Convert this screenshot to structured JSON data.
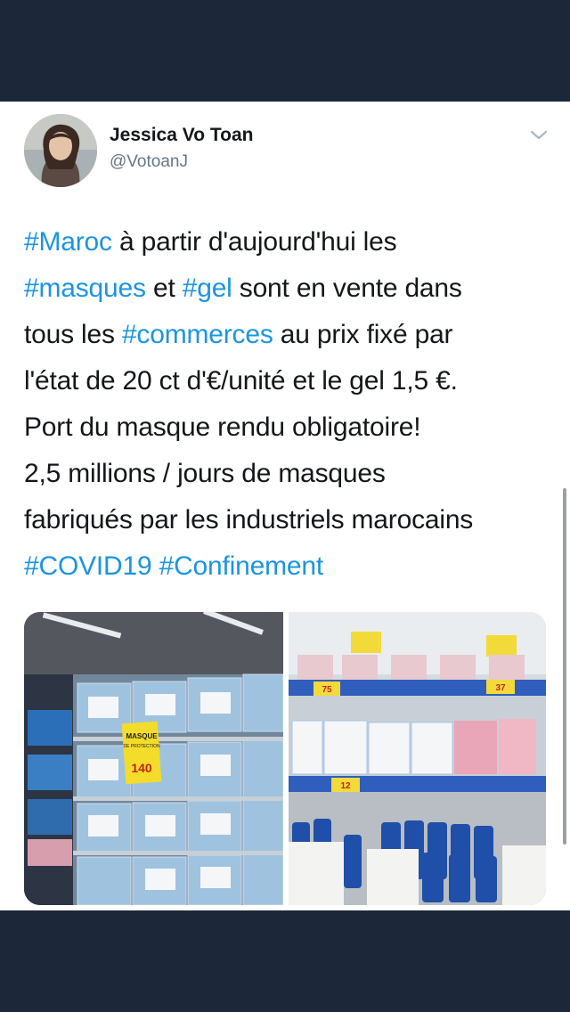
{
  "author": {
    "name": "Jessica Vo Toan",
    "handle": "@VotoanJ"
  },
  "tweet": {
    "lines": [
      [
        {
          "text": "#Maroc",
          "tag": true
        },
        {
          "text": " à partir d'aujourd'hui les",
          "tag": false
        }
      ],
      [
        {
          "text": "#masques",
          "tag": true
        },
        {
          "text": " et ",
          "tag": false
        },
        {
          "text": "#gel",
          "tag": true
        },
        {
          "text": " sont en vente dans",
          "tag": false
        }
      ],
      [
        {
          "text": "tous les ",
          "tag": false
        },
        {
          "text": "#commerces",
          "tag": true
        },
        {
          "text": " au prix fixé par",
          "tag": false
        }
      ],
      [
        {
          "text": "l'état de 20 ct d'€/unité et le gel 1,5 €.",
          "tag": false
        }
      ],
      [
        {
          "text": "Port du masque rendu obligatoire!",
          "tag": false
        }
      ],
      [
        {
          "text": "2,5 millions / jours de masques",
          "tag": false
        }
      ],
      [
        {
          "text": "fabriqués par les industriels marocains",
          "tag": false
        }
      ],
      [
        {
          "text": "#COVID19",
          "tag": true
        },
        {
          "text": " ",
          "tag": false
        },
        {
          "text": "#Confinement",
          "tag": true
        }
      ]
    ]
  },
  "photo_left": {
    "price_tag_title": "MASQUE",
    "price_tag_subtitle": "DE PROTECTION",
    "price": "140"
  },
  "photo_right": {
    "price_tags": [
      "75",
      "37",
      "12"
    ]
  },
  "colors": {
    "background": "#1c2739",
    "card": "#ffffff",
    "hashtag": "#1b95e0",
    "text": "#14171a",
    "secondary": "#657786"
  },
  "icons": {
    "menu": "chevron-down-icon"
  }
}
